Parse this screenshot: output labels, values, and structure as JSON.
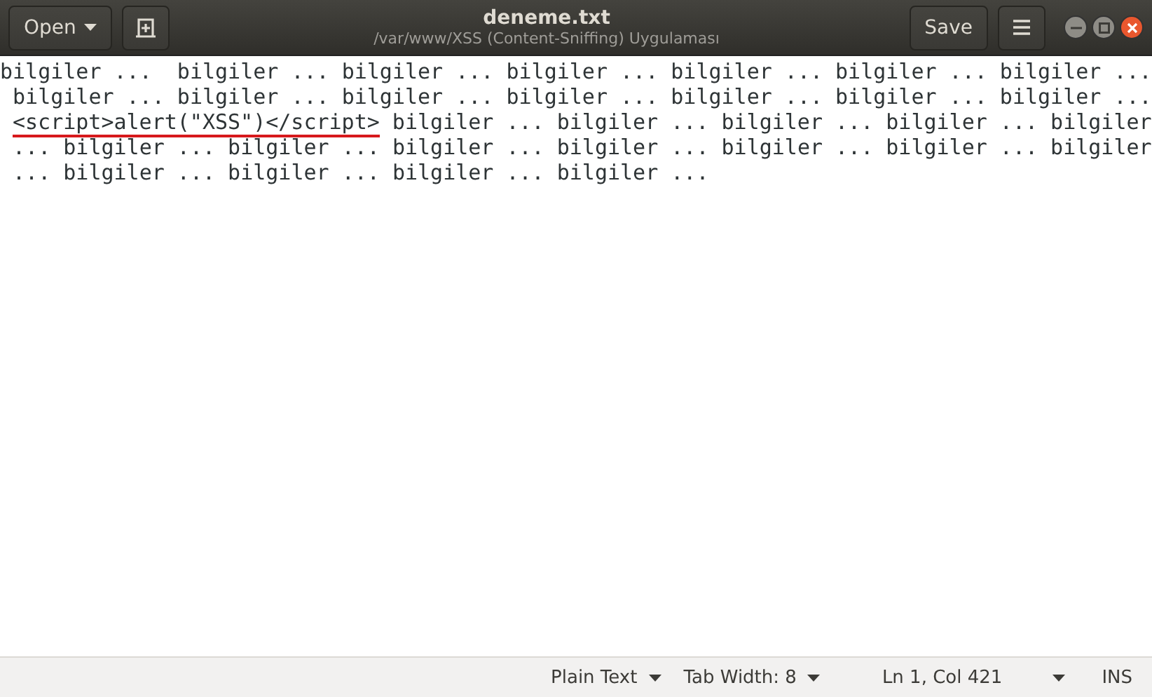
{
  "header": {
    "open_button": "Open",
    "title": "deneme.txt",
    "subtitle": "/var/www/XSS (Content-Sniffing) Uygulaması",
    "save_button": "Save"
  },
  "document": {
    "lines": [
      {
        "text": "bilgiler ...  bilgiler ... bilgiler ... bilgiler ... bilgiler ... bilgiler ... bilgiler ..."
      },
      {
        "text": " bilgiler ... bilgiler ... bilgiler ... bilgiler ... bilgiler ... bilgiler ... bilgiler ..."
      },
      {
        "underlined_code": "<script>alert(\"XSS\")</script>",
        "text": " bilgiler ... bilgiler ... bilgiler ... bilgiler ... bilgiler"
      },
      {
        "text": " ... bilgiler ... bilgiler ... bilgiler ... bilgiler ... bilgiler ... bilgiler ... bilgiler"
      },
      {
        "text": " ... bilgiler ... bilgiler ... bilgiler ... bilgiler ..."
      }
    ]
  },
  "status_bar": {
    "language": "Plain Text",
    "tab_width": "Tab Width: 8",
    "position": "Ln 1, Col 421",
    "mode": "INS"
  }
}
